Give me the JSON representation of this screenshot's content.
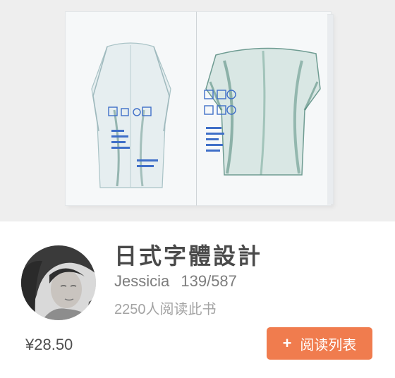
{
  "hero": {
    "image": "book-spread-photo"
  },
  "book": {
    "title": "日式字體設計",
    "author": "Jessicia",
    "progress": "139/587",
    "readers": "2250人阅读此书",
    "price": "¥28.50",
    "avatar": "author-avatar"
  },
  "actions": {
    "add_icon": "+",
    "add_label": "阅读列表"
  },
  "colors": {
    "accent": "#f07c4e",
    "title": "#4a4a4a",
    "muted": "#a3a3a3"
  }
}
